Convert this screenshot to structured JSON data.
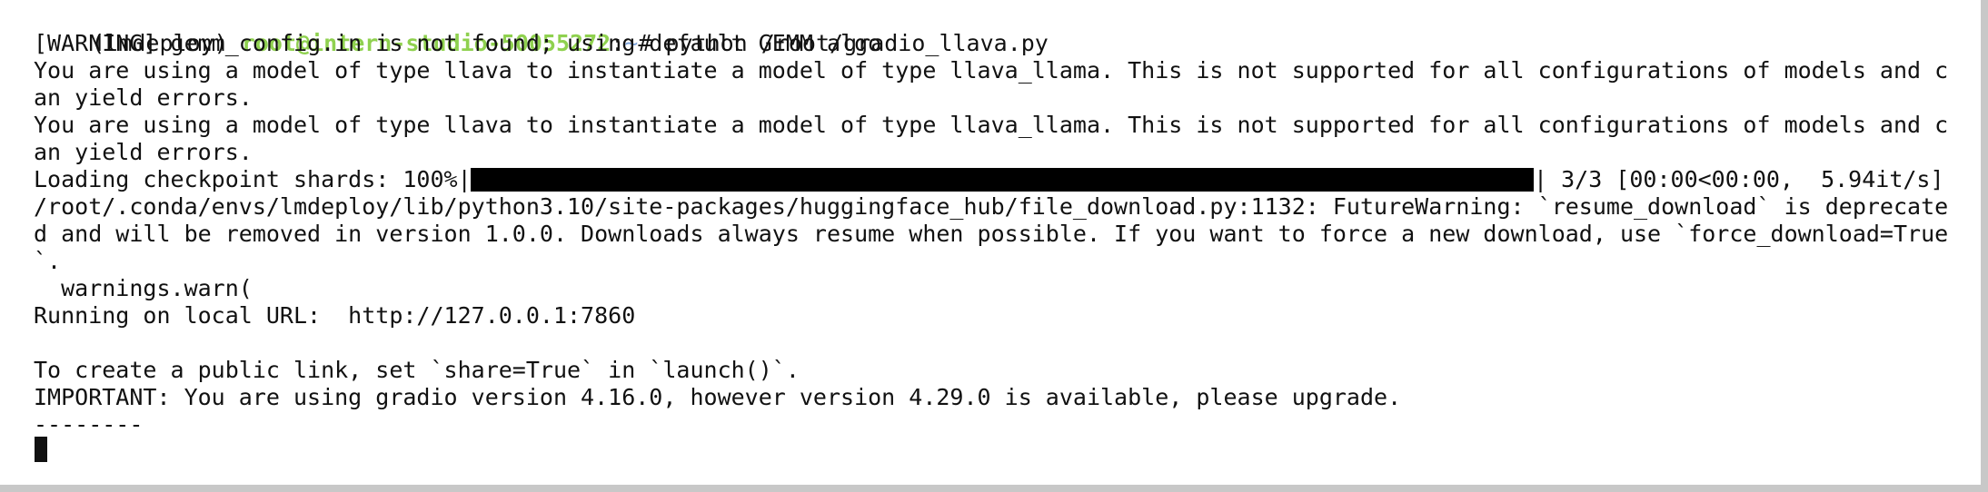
{
  "terminal": {
    "prompt": {
      "env": "(lmdeploy) ",
      "user_host": "root@intern-studio-50055272",
      "separator": ":",
      "path": "~",
      "symbol": "# ",
      "command": "python /root/gradio_llava.py"
    },
    "lines": {
      "warning_gemm": "[WARNING] gemm_config.in is not found; using default GEMM algo",
      "model_type_1a": "You are using a model of type llava to instantiate a model of type llava_llama. This is not supported for all configurations of models and c",
      "model_type_1b": "an yield errors.",
      "model_type_2a": "You are using a model of type llava to instantiate a model of type llava_llama. This is not supported for all configurations of models and c",
      "model_type_2b": "an yield errors.",
      "future_warning_a": "/root/.conda/envs/lmdeploy/lib/python3.10/site-packages/huggingface_hub/file_download.py:1132: FutureWarning: `resume_download` is deprecate",
      "future_warning_b": "d and will be removed in version 1.0.0. Downloads always resume when possible. If you want to force a new download, use `force_download=True",
      "future_warning_c": "`.",
      "warnings_warn": "  warnings.warn(",
      "running_url": "Running on local URL:  http://127.0.0.1:7860",
      "blank": "",
      "public_link": "To create a public link, set `share=True` in `launch()`.",
      "important": "IMPORTANT: You are using gradio version 4.16.0, however version 4.29.0 is available, please upgrade.",
      "dashes": "--------"
    },
    "progress": {
      "label": "Loading checkpoint shards: 100%|",
      "fraction": 1.0,
      "suffix": "| 3/3 [00:00<00:00,  5.94it/s]"
    },
    "colors": {
      "user_host": "#8fd14f",
      "path": "#7aa0d8",
      "text": "#111111",
      "background": "#ffffff"
    }
  }
}
